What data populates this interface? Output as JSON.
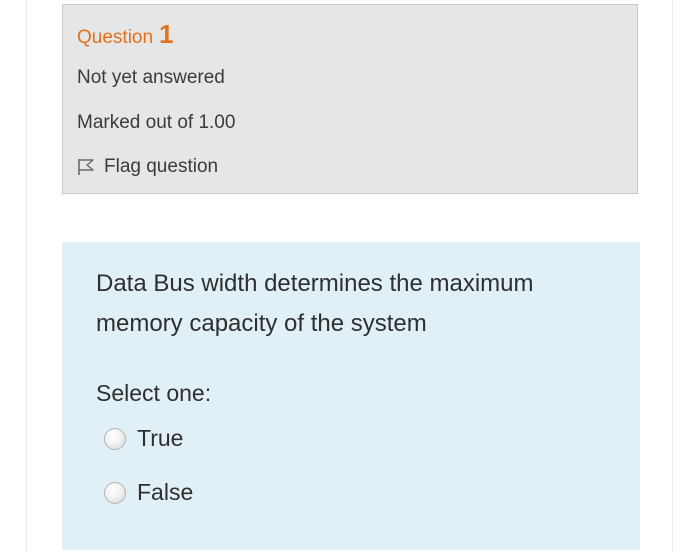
{
  "question_info": {
    "label": "Question",
    "number": "1",
    "state": "Not yet answered",
    "grade": "Marked out of 1.00",
    "flag_label": "Flag question",
    "flag_icon": "flag-outline-icon"
  },
  "question_content": {
    "text": "Data Bus width determines the maximum memory capacity of the system",
    "prompt": "Select one:",
    "answers": [
      {
        "label": "True",
        "selected": false
      },
      {
        "label": "False",
        "selected": false
      }
    ]
  },
  "colors": {
    "accent": "#e2711d",
    "info_background": "#e6e6e6",
    "content_background": "#e1f0f7",
    "text": "#2f2f2f"
  }
}
